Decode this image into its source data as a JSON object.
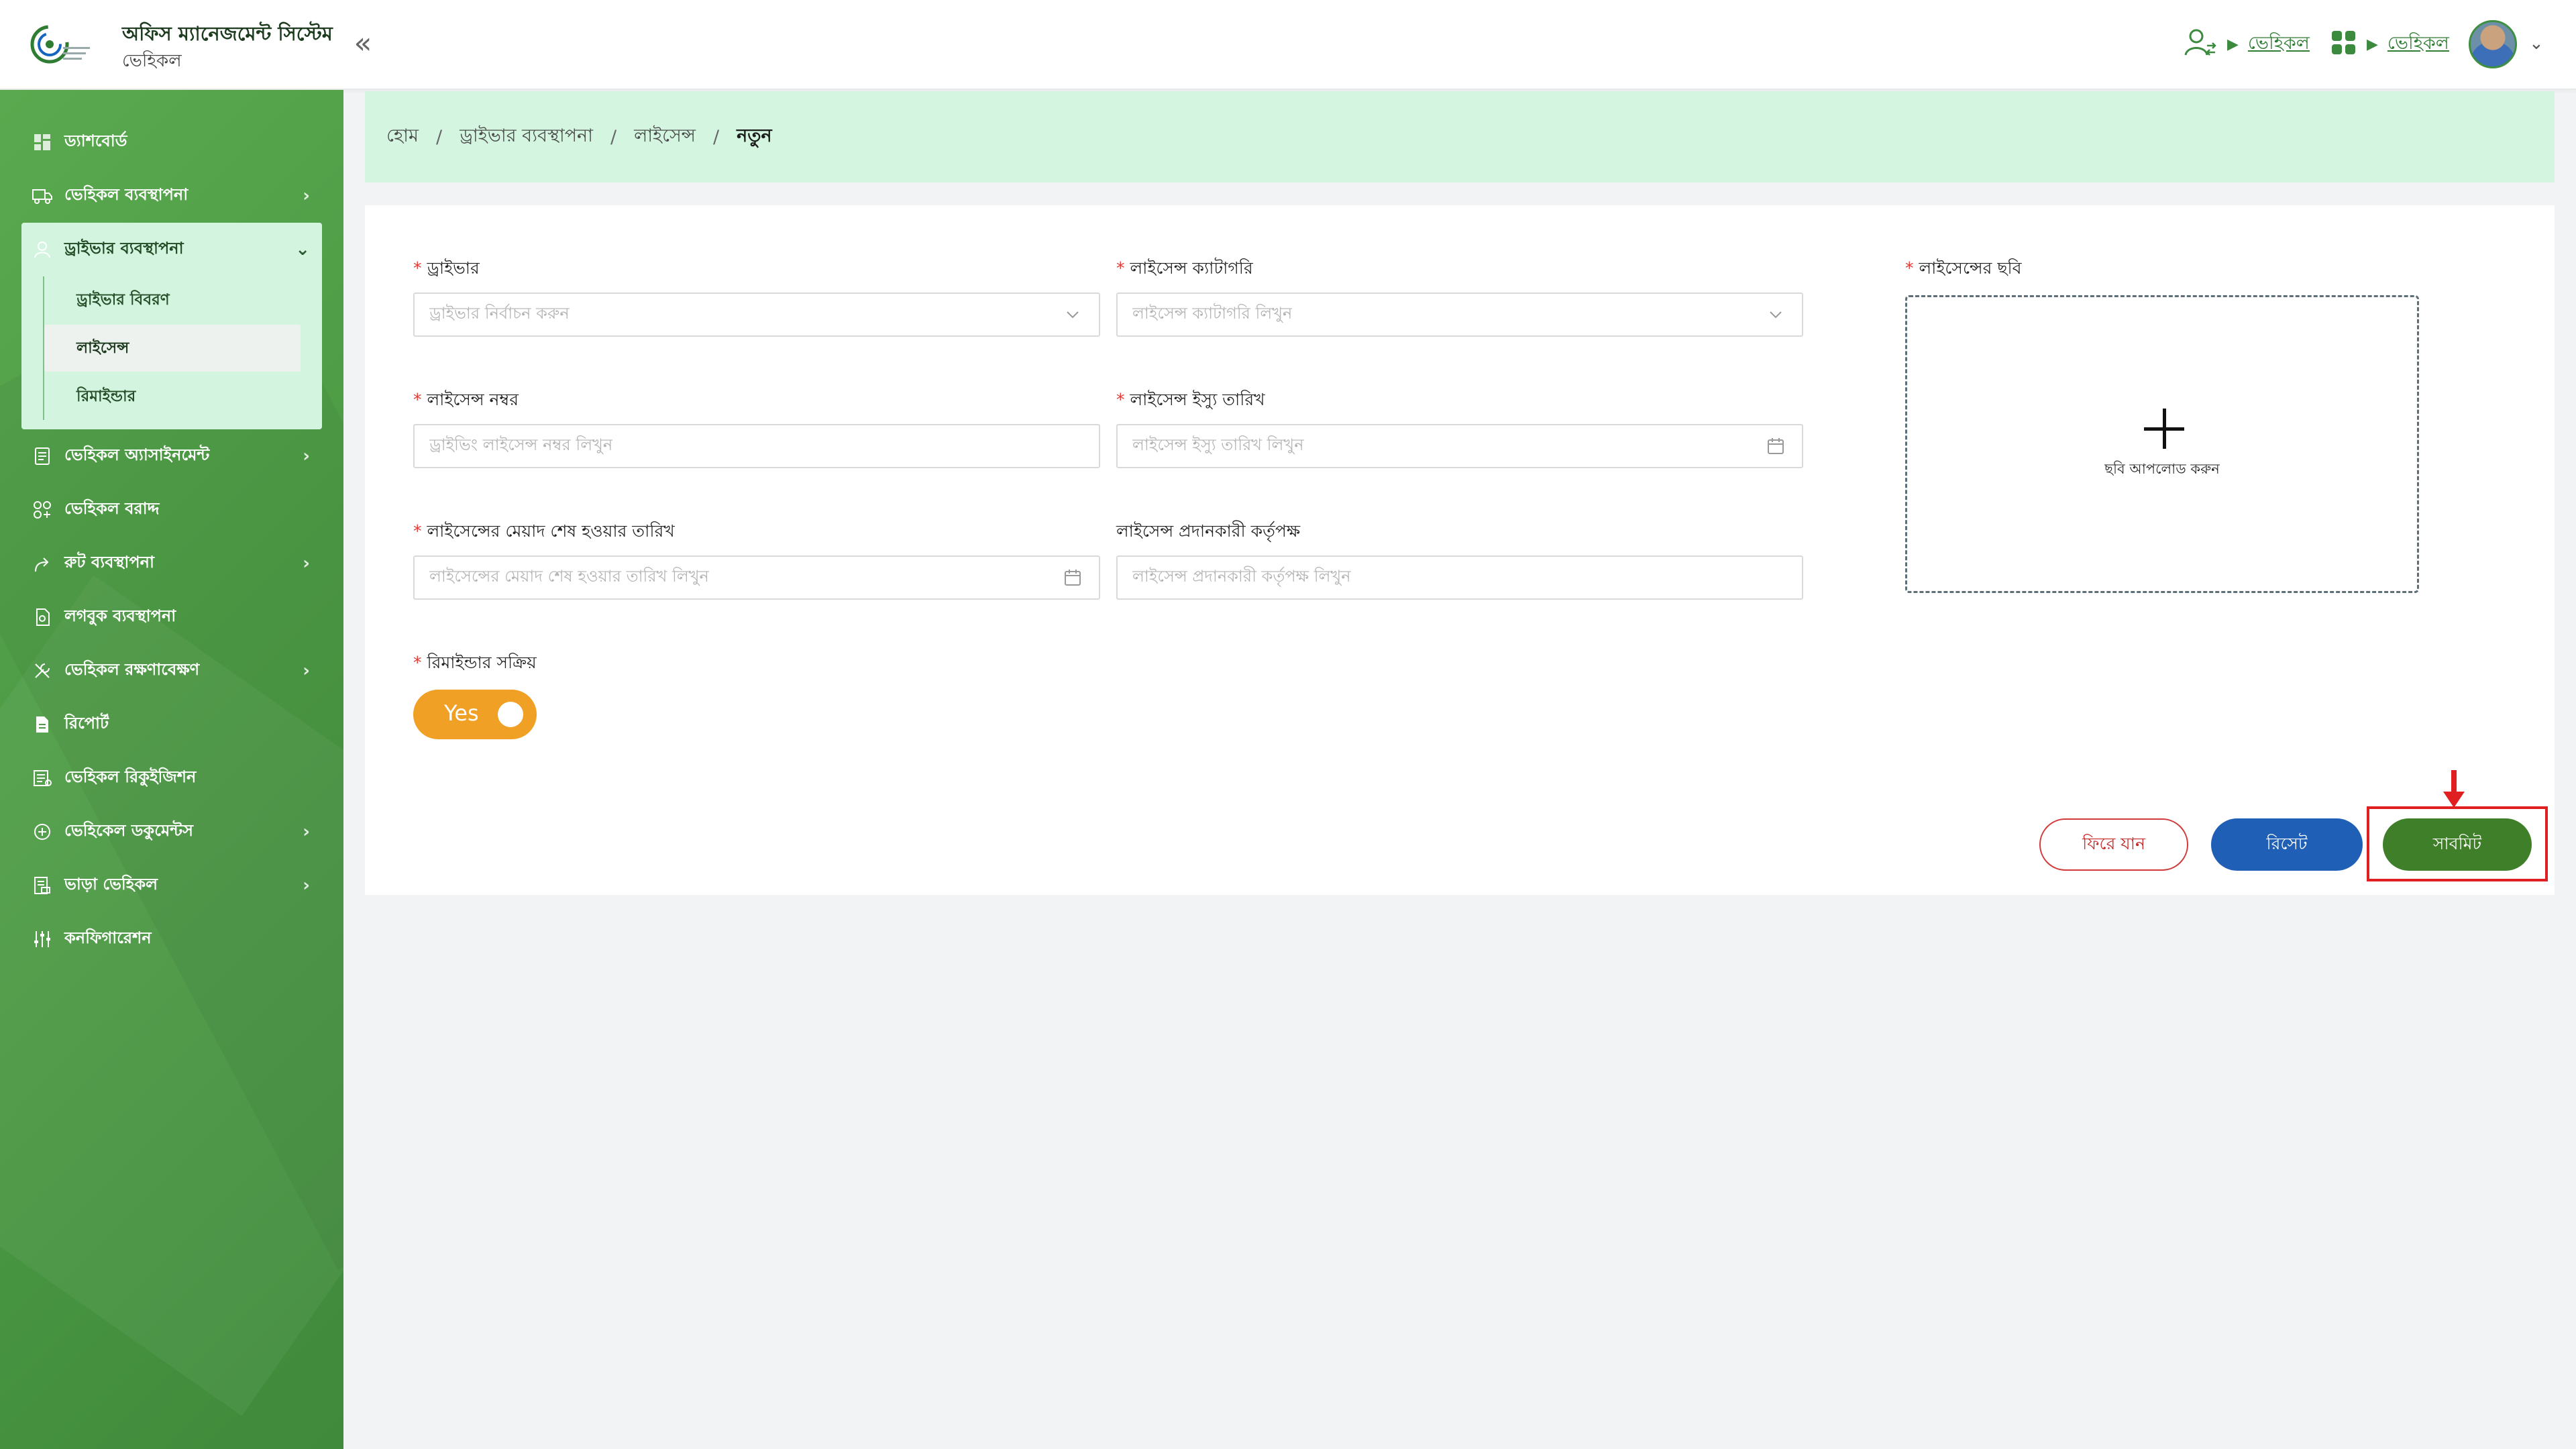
{
  "header": {
    "app_title": "অফিস ম্যানেজমেন্ট সিস্টেম",
    "app_subtitle": "ভেহিকল",
    "collapse_glyph": "«",
    "link_1": "ভেহিকল",
    "link_2": "ভেহিকল"
  },
  "sidebar": {
    "items": [
      {
        "label": "ড্যাশবোর্ড",
        "icon": "dashboard-icon"
      },
      {
        "label": "ভেহিকল ব্যবস্থাপনা",
        "icon": "truck-icon"
      },
      {
        "label": "ড্রাইভার ব্যবস্থাপনা",
        "icon": "driver-icon"
      },
      {
        "label": "ভেহিকল অ্যাসাইনমেন্ট",
        "icon": "assignment-icon"
      },
      {
        "label": "ভেহিকল বরাদ্দ",
        "icon": "allocation-icon"
      },
      {
        "label": "রুট ব্যবস্থাপনা",
        "icon": "route-icon"
      },
      {
        "label": "লগবুক ব্যবস্থাপনা",
        "icon": "logbook-icon"
      },
      {
        "label": "ভেহিকল রক্ষণাবেক্ষণ",
        "icon": "wrench-icon"
      },
      {
        "label": "রিপোর্ট",
        "icon": "report-icon"
      },
      {
        "label": "ভেহিকল রিকুইজিশন",
        "icon": "requisition-icon"
      },
      {
        "label": "ভেহিকেল ডকুমেন্টস",
        "icon": "documents-icon"
      },
      {
        "label": "ভাড়া ভেহিকল",
        "icon": "rental-icon"
      },
      {
        "label": "কনফিগারেশন",
        "icon": "sliders-icon"
      }
    ],
    "submenu": [
      {
        "label": "ড্রাইভার বিবরণ"
      },
      {
        "label": "লাইসেন্স"
      },
      {
        "label": "রিমাইন্ডার"
      }
    ]
  },
  "breadcrumb": {
    "home": "হোম",
    "level1": "ড্রাইভার ব্যবস্থাপনা",
    "level2": "লাইসেন্স",
    "current": "নতুন",
    "separator": "/"
  },
  "form": {
    "required_mark": "*",
    "driver": {
      "label": "ড্রাইভার",
      "placeholder": "ড্রাইভার নির্বাচন করুন"
    },
    "license_category": {
      "label": "লাইসেন্স ক্যাটাগরি",
      "placeholder": "লাইসেন্স ক্যাটাগরি লিখুন"
    },
    "license_number": {
      "label": "লাইসেন্স নম্বর",
      "placeholder": "ড্রাইভিং লাইসেন্স নম্বর লিখুন"
    },
    "issue_date": {
      "label": "লাইসেন্স ইস্যু তারিখ",
      "placeholder": "লাইসেন্স ইস্যু তারিখ লিখুন"
    },
    "expiry_date": {
      "label": "লাইসেন্সের মেয়াদ শেষ হওয়ার তারিখ",
      "placeholder": "লাইসেন্সের মেয়াদ শেষ হওয়ার তারিখ লিখুন"
    },
    "issuing_authority": {
      "label": "লাইসেন্স প্রদানকারী কর্তৃপক্ষ",
      "placeholder": "লাইসেন্স প্রদানকারী কর্তৃপক্ষ লিখুন"
    },
    "reminder": {
      "label": "রিমাইন্ডার সক্রিয়",
      "value": "Yes"
    },
    "photo": {
      "label": "লাইসেন্সের ছবি",
      "upload_text": "ছবি আপলোড করুন"
    }
  },
  "buttons": {
    "back": "ফিরে যান",
    "reset": "রিসেট",
    "submit": "সাবমিট"
  },
  "colors": {
    "sidebar_green": "#4e9d46",
    "breadcrumb_bg": "#d4f6e1",
    "toggle_orange": "#f0a024",
    "reset_blue": "#1f5fb6",
    "submit_green": "#3f7f2a",
    "highlight_red": "#e02020"
  }
}
